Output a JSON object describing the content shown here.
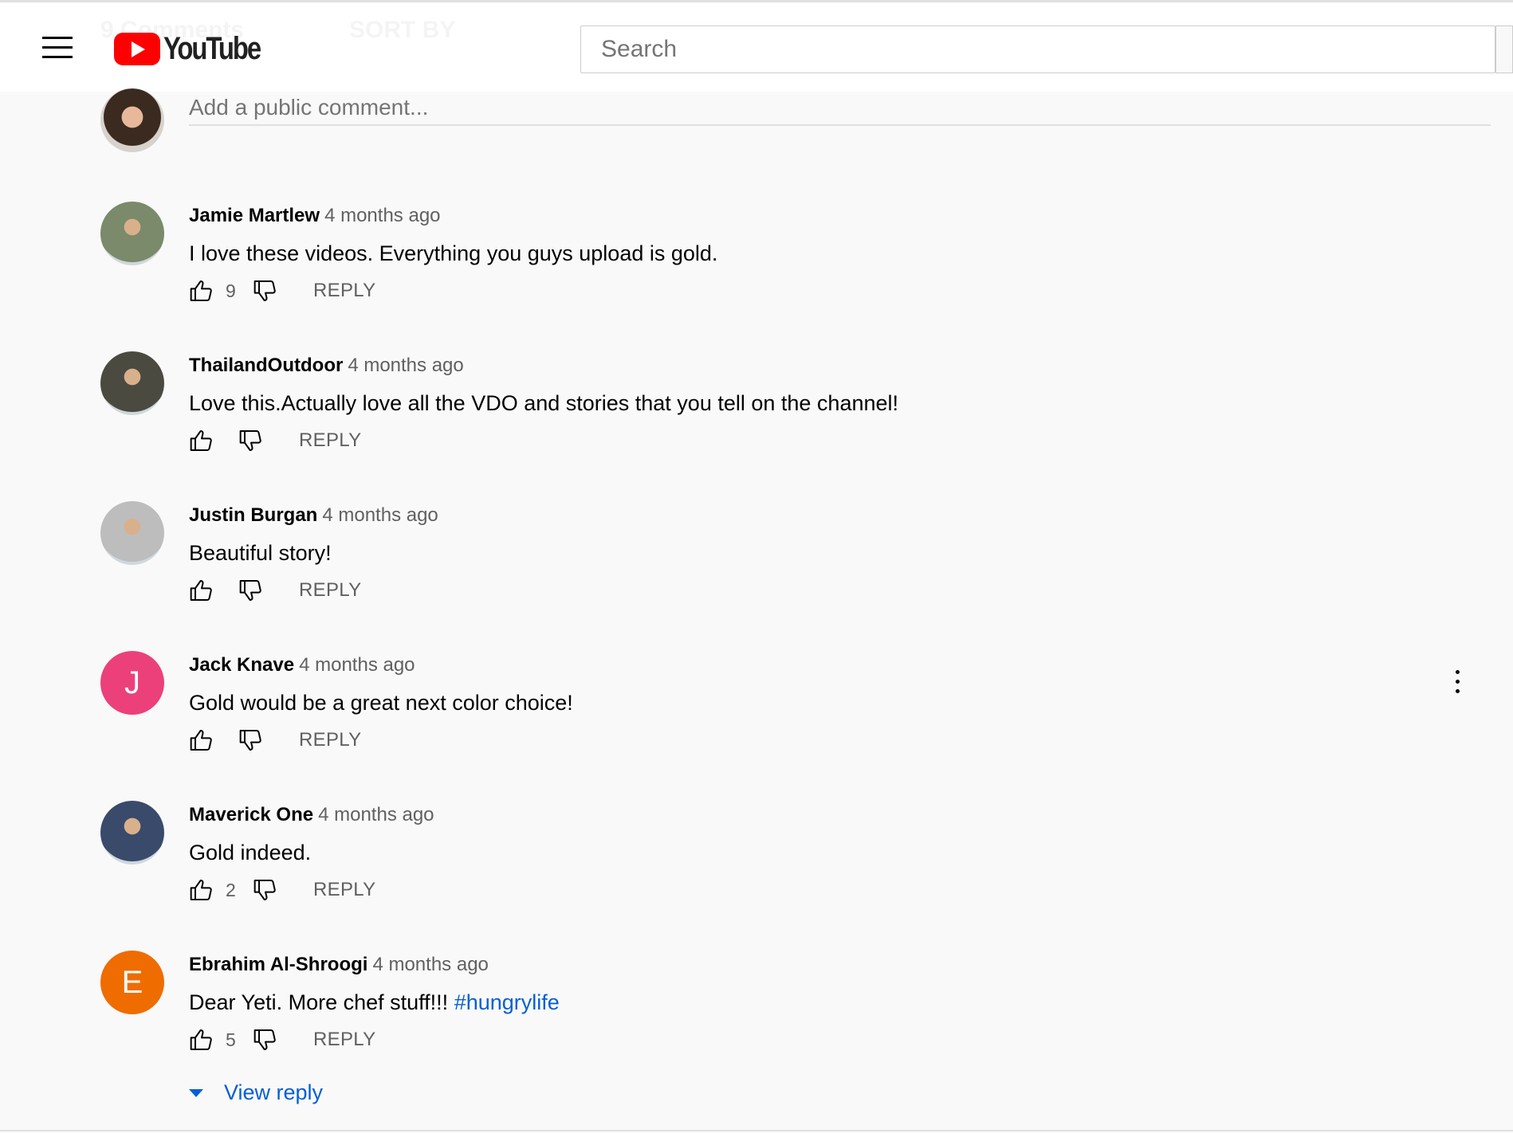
{
  "header": {
    "brand": "YouTube",
    "search_placeholder": "Search",
    "ghost_count": "9 Comments",
    "ghost_sort": "SORT BY"
  },
  "add_comment": {
    "placeholder": "Add a public comment..."
  },
  "reply_label": "REPLY",
  "comments": [
    {
      "author": "Jamie Martlew",
      "time": "4 months ago",
      "text": "I love these videos. Everything you guys upload is gold.",
      "hashtag": "",
      "likes": "9",
      "avatar": "photo",
      "avatar_color": "#7a8a6a"
    },
    {
      "author": "ThailandOutdoor",
      "time": "4 months ago",
      "text": "Love this.Actually love all the VDO and stories that you tell on the channel!",
      "hashtag": "",
      "likes": "",
      "avatar": "photo",
      "avatar_color": "#4a4a40"
    },
    {
      "author": "Justin Burgan",
      "time": "4 months ago",
      "text": "Beautiful story!",
      "hashtag": "",
      "likes": "",
      "avatar": "photo",
      "avatar_color": "#bdbdbd"
    },
    {
      "author": "Jack Knave",
      "time": "4 months ago",
      "text": "Gold would be a great next color choice!",
      "hashtag": "",
      "likes": "",
      "avatar": "letter",
      "initial": "J",
      "avatar_color": "#ec407a",
      "has_menu": true
    },
    {
      "author": "Maverick One",
      "time": "4 months ago",
      "text": "Gold indeed.",
      "hashtag": "",
      "likes": "2",
      "avatar": "photo",
      "avatar_color": "#3a4a6a"
    },
    {
      "author": "Ebrahim Al-Shroogi",
      "time": "4 months ago",
      "text": "Dear Yeti. More chef stuff!!! ",
      "hashtag": "#hungrylife",
      "likes": "5",
      "avatar": "letter",
      "initial": "E",
      "avatar_color": "#ef6c00"
    }
  ],
  "view_reply": "View reply",
  "colors": {
    "link": "#065fd4",
    "brand_red": "#ff0000"
  }
}
